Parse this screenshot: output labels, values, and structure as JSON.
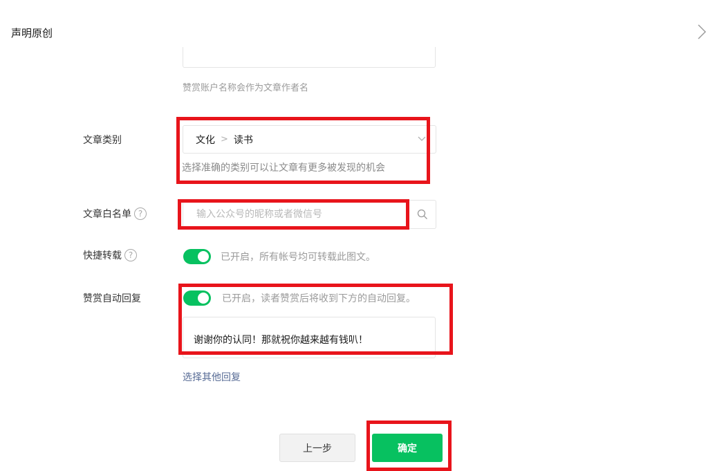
{
  "header": {
    "title": "声明原创",
    "next_icon": "chevron-right-icon"
  },
  "reward": {
    "hint": "赞赏账户名称会作为文章作者名"
  },
  "category": {
    "label": "文章类别",
    "primary": "文化",
    "separator": ">",
    "secondary": "读书",
    "hint": "选择准确的类别可以让文章有更多被发现的机会"
  },
  "whitelist": {
    "label": "文章白名单",
    "help": "?",
    "placeholder": "输入公众号的昵称或者微信号",
    "search_icon": "search-icon"
  },
  "quick_repost": {
    "label": "快捷转载",
    "help": "?",
    "enabled": true,
    "status_text": "已开启，所有帐号均可转载此图文。"
  },
  "auto_reply": {
    "label": "赞赏自动回复",
    "enabled": true,
    "status_text": "已开启，读者赞赏后将收到下方的自动回复。",
    "message": "谢谢你的认同！那就祝你越来越有钱叭！",
    "choose_other": "选择其他回复"
  },
  "footer": {
    "prev_label": "上一步",
    "confirm_label": "确定"
  },
  "colors": {
    "accent_green": "#07c160",
    "link_blue": "#576b95",
    "annotation_red": "#e8141b"
  }
}
